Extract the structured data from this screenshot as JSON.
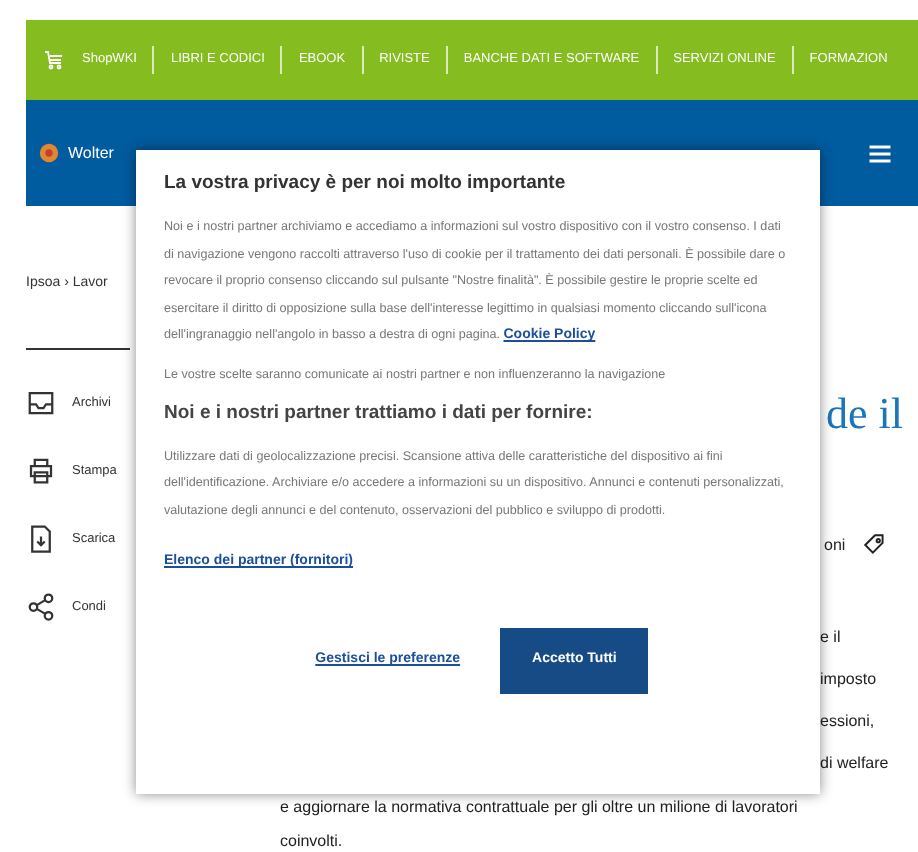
{
  "top_bar": {
    "brand": "ShopWKI",
    "links": [
      "LIBRI E CODICI",
      "EBOOK",
      "RIVISTE",
      "BANCHE DATI E SOFTWARE",
      "SERVIZI ONLINE",
      "FORMAZION"
    ]
  },
  "header": {
    "brand": "Wolter"
  },
  "breadcrumb": "Ipsoa › Lavor",
  "actions": [
    {
      "kind": "archive",
      "label": "Archivi"
    },
    {
      "kind": "print",
      "label": "Stampa"
    },
    {
      "kind": "download",
      "label": "Scarica"
    },
    {
      "kind": "share",
      "label": "Condi"
    }
  ],
  "article": {
    "title_fragment": "de il",
    "tag_fragment": "oni",
    "line_fragments": [
      "e il",
      "imposto",
      "essioni,",
      "di welfare"
    ],
    "paragraph_lines": [
      "e aggiornare la normativa contrattuale per gli oltre un milione di lavoratori",
      "coinvolti."
    ]
  },
  "consent_dialog": {
    "title": "La vostra privacy è per noi molto importante",
    "intro": "Noi e i nostri partner archiviamo e accediamo a informazioni sul vostro dispositivo con il vostro consenso. I dati di navigazione vengono raccolti attraverso l'uso di cookie per il trattamento dei dati personali. È possibile dare o revocare il proprio consenso cliccando sul pulsante \"Nostre finalità\". È possibile gestire le proprie scelte ed esercitare il diritto di opposizione sulla base dell'interesse legittimo in qualsiasi momento cliccando sull'icona dell'ingranaggio nell'angolo in basso a destra di ogni pagina.",
    "cookie_link": "Cookie Policy",
    "notice": "Le vostre scelte saranno comunicate ai nostri partner e non influenzeranno la navigazione",
    "purposes_heading": "Noi e i nostri partner trattiamo i dati per fornire:",
    "purposes": "Utilizzare dati di geolocalizzazione precisi. Scansione attiva delle caratteristiche del dispositivo ai fini dell'identificazione. Archiviare e/o accedere a informazioni su un dispositivo. Annunci e contenuti personalizzati, valutazione degli annunci e del contenuto, osservazioni del pubblico e sviluppo di prodotti.",
    "partners_link": "Elenco dei partner (fornitori)",
    "manage_button": "Gestisci le preferenze",
    "accept_button": "Accetto Tutti"
  }
}
